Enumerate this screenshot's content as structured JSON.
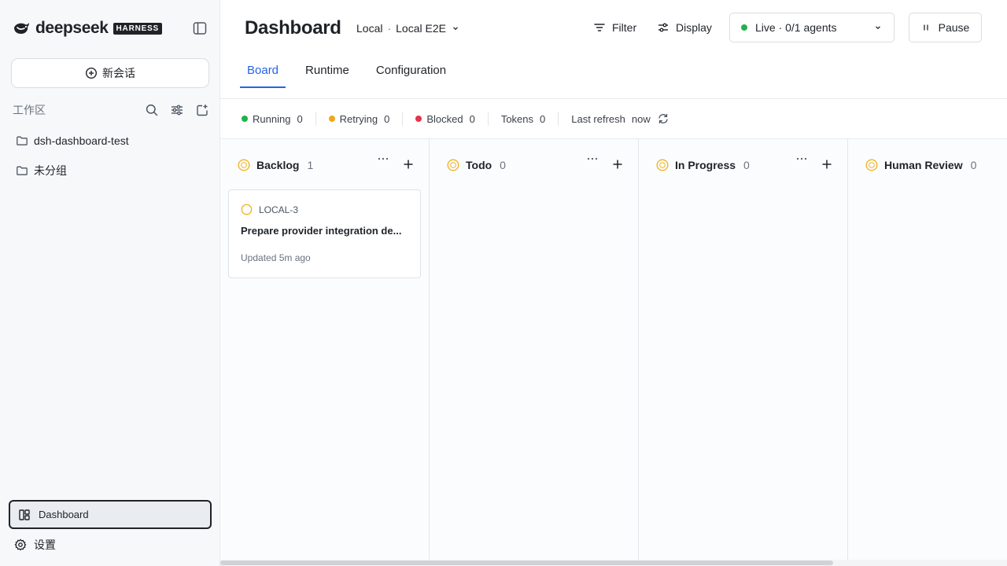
{
  "brand": {
    "name": "deepseek",
    "badge": "HARNESS"
  },
  "sidebar": {
    "new_chat_label": "新会话",
    "workspace_label": "工作区",
    "folders": [
      {
        "label": "dsh-dashboard-test"
      },
      {
        "label": "未分组"
      }
    ],
    "nav": {
      "dashboard_label": "Dashboard",
      "settings_label": "设置"
    }
  },
  "header": {
    "title": "Dashboard",
    "env": {
      "primary": "Local",
      "separator": "·",
      "secondary": "Local E2E"
    },
    "filter_label": "Filter",
    "display_label": "Display",
    "live_select_value": "Live · 0/1 agents",
    "pause_label": "Pause"
  },
  "tabs": [
    {
      "label": "Board",
      "active": true
    },
    {
      "label": "Runtime",
      "active": false
    },
    {
      "label": "Configuration",
      "active": false
    }
  ],
  "stats": {
    "running": {
      "label": "Running",
      "value": "0",
      "color": "#22b14c"
    },
    "retrying": {
      "label": "Retrying",
      "value": "0",
      "color": "#f0a81a"
    },
    "blocked": {
      "label": "Blocked",
      "value": "0",
      "color": "#e5334b"
    },
    "tokens": {
      "label": "Tokens",
      "value": "0"
    },
    "last_refresh": {
      "label": "Last refresh",
      "value": "now"
    }
  },
  "board": {
    "columns": [
      {
        "title": "Backlog",
        "count": "1",
        "cards": [
          {
            "id": "LOCAL-3",
            "title": "Prepare provider integration de...",
            "meta": "Updated 5m ago"
          }
        ]
      },
      {
        "title": "Todo",
        "count": "0",
        "cards": []
      },
      {
        "title": "In Progress",
        "count": "0",
        "cards": []
      },
      {
        "title": "Human Review",
        "count": "0",
        "cards": []
      }
    ]
  },
  "colors": {
    "accent": "#2563eb",
    "status_ring": "#f0b429",
    "live_dot": "#22b14c"
  },
  "icons": {
    "logo": "whale-logo-icon",
    "collapse": "sidebar-toggle-icon",
    "new_chat": "plus-circle-icon",
    "search": "search-icon",
    "filter": "sliders-icon",
    "new_folder": "folder-plus-icon",
    "folder": "folder-icon",
    "dashboard": "layout-icon",
    "settings": "gear-icon",
    "refresh": "refresh-icon",
    "pause": "pause-icon",
    "more": "ellipsis-icon",
    "add": "plus-icon"
  }
}
